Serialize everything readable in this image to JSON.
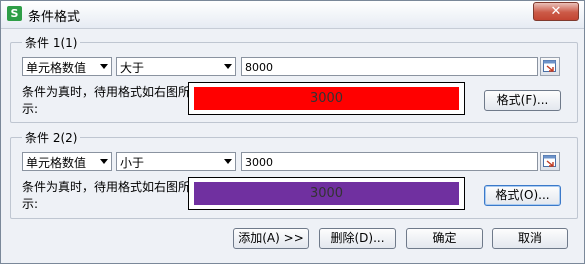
{
  "window": {
    "title": "条件格式",
    "app_icon_letter": "S",
    "close_glyph": "✕"
  },
  "conditions": [
    {
      "legend": "条件 1(1)",
      "type_value": "单元格数值",
      "operator_value": "大于",
      "input_value": "8000",
      "description": "条件为真时，待用格式如右图所示:",
      "preview_text": "3000",
      "preview_color": "#ff0000",
      "format_button": "格式(F)..."
    },
    {
      "legend": "条件 2(2)",
      "type_value": "单元格数值",
      "operator_value": "小于",
      "input_value": "3000",
      "description": "条件为真时，待用格式如右图所示:",
      "preview_text": "3000",
      "preview_color": "#7030a0",
      "format_button": "格式(O)..."
    }
  ],
  "buttons": {
    "add": "添加(A) >>",
    "delete": "删除(D)...",
    "ok": "确定",
    "cancel": "取消"
  }
}
